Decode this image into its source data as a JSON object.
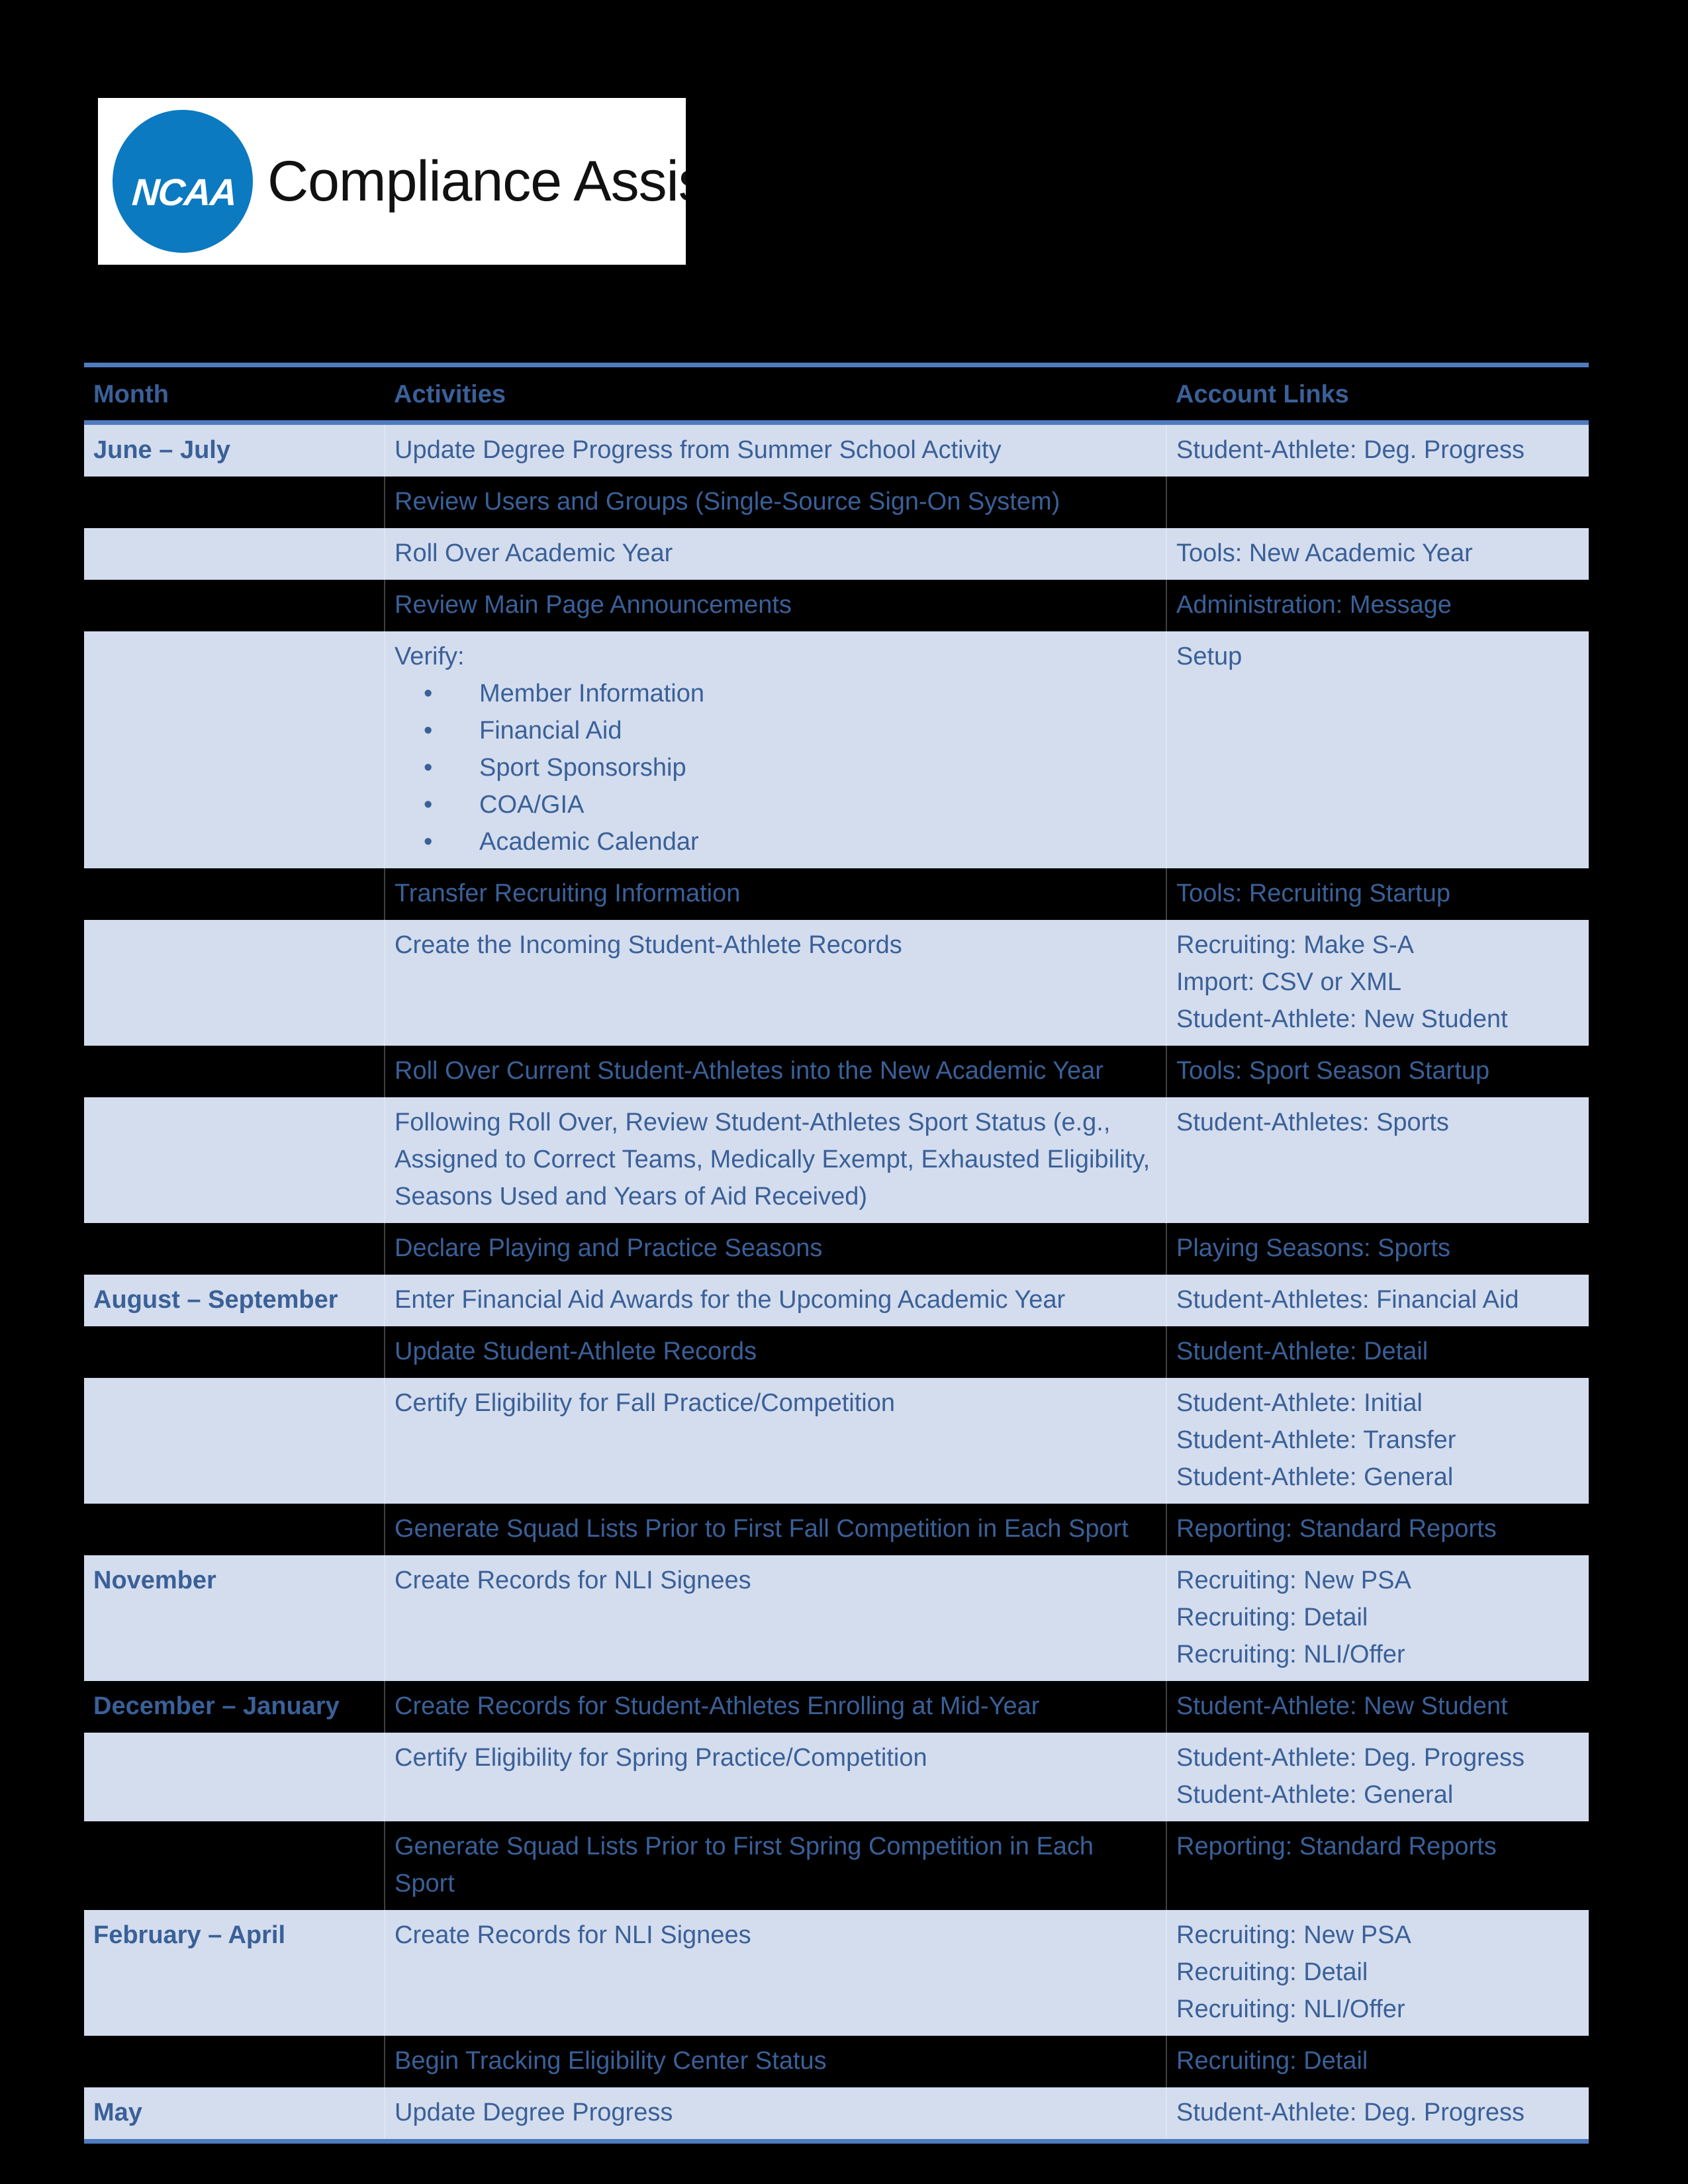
{
  "logo": {
    "mark_text": "NCAA",
    "registered_mark": "®",
    "wordmark": "Compliance Assistant",
    "oval_color": "#0c7ac0"
  },
  "theme": {
    "band_color": "#d4ddee",
    "rule_color": "#4f7cc0",
    "text_color": "#3a6098",
    "page_background": "#000000"
  },
  "table": {
    "headers": {
      "month": "Month",
      "activities": "Activities",
      "account_links": "Account Links"
    },
    "rows": [
      {
        "month": "June – July",
        "activity": "Update Degree Progress from Summer School Activity",
        "link": "Student-Athlete: Deg. Progress"
      },
      {
        "month": "",
        "activity": "Review Users and Groups (Single-Source Sign-On System)",
        "link": ""
      },
      {
        "month": "",
        "activity": "Roll Over Academic Year",
        "link": "Tools:  New Academic Year"
      },
      {
        "month": "",
        "activity": "Review Main Page Announcements",
        "link": "Administration:  Message"
      },
      {
        "month": "",
        "activity_heading": "Verify:",
        "activity_bullets": [
          "Member Information",
          "Financial Aid",
          "Sport Sponsorship",
          "COA/GIA",
          "Academic Calendar"
        ],
        "link": "Setup"
      },
      {
        "month": "",
        "activity": "Transfer Recruiting Information",
        "link": "Tools:  Recruiting Startup"
      },
      {
        "month": "",
        "activity": "Create the Incoming Student-Athlete Records",
        "link_lines": [
          "Recruiting:  Make S-A",
          "Import:  CSV or XML",
          "Student-Athlete:  New Student"
        ]
      },
      {
        "month": "",
        "activity": "Roll Over Current Student-Athletes into the New Academic Year",
        "link": "Tools:  Sport Season Startup"
      },
      {
        "month": "",
        "activity": "Following Roll Over, Review Student-Athletes Sport Status (e.g., Assigned to Correct Teams, Medically Exempt, Exhausted Eligibility, Seasons Used and Years of Aid Received)",
        "link": "Student-Athletes:  Sports"
      },
      {
        "month": "",
        "activity": "Declare Playing and Practice Seasons",
        "link": "Playing Seasons:  Sports"
      },
      {
        "month": "August – September",
        "activity": "Enter Financial Aid Awards for the Upcoming Academic Year",
        "link": "Student-Athletes:  Financial Aid"
      },
      {
        "month": "",
        "activity": "Update Student-Athlete Records",
        "link": "Student-Athlete:  Detail"
      },
      {
        "month": "",
        "activity": "Certify Eligibility for Fall Practice/Competition",
        "link_lines": [
          "Student-Athlete:  Initial",
          "Student-Athlete:  Transfer",
          "Student-Athlete:  General"
        ]
      },
      {
        "month": "",
        "activity": "Generate Squad Lists Prior to First Fall Competition in Each Sport",
        "link": "Reporting: Standard Reports"
      },
      {
        "month": "November",
        "activity": "Create Records for NLI Signees",
        "link_lines": [
          "Recruiting:  New PSA",
          "Recruiting:  Detail",
          "Recruiting:  NLI/Offer"
        ]
      },
      {
        "month": "December – January",
        "activity": "Create Records for Student-Athletes Enrolling at Mid-Year",
        "link": "Student-Athlete: New Student"
      },
      {
        "month": "",
        "activity": "Certify Eligibility for Spring Practice/Competition",
        "link_lines": [
          "Student-Athlete:  Deg. Progress",
          "Student-Athlete:  General"
        ]
      },
      {
        "month": "",
        "activity": "Generate Squad Lists Prior to First Spring Competition in Each Sport",
        "link": "Reporting:  Standard Reports"
      },
      {
        "month": "February – April",
        "activity": "Create Records for NLI Signees",
        "link_lines": [
          "Recruiting:  New PSA",
          "Recruiting:  Detail",
          "Recruiting:  NLI/Offer"
        ]
      },
      {
        "month": "",
        "activity": "Begin Tracking Eligibility Center Status",
        "link": "Recruiting:  Detail"
      },
      {
        "month": "May",
        "activity": "Update Degree Progress",
        "link": "Student-Athlete:  Deg. Progress"
      }
    ]
  }
}
